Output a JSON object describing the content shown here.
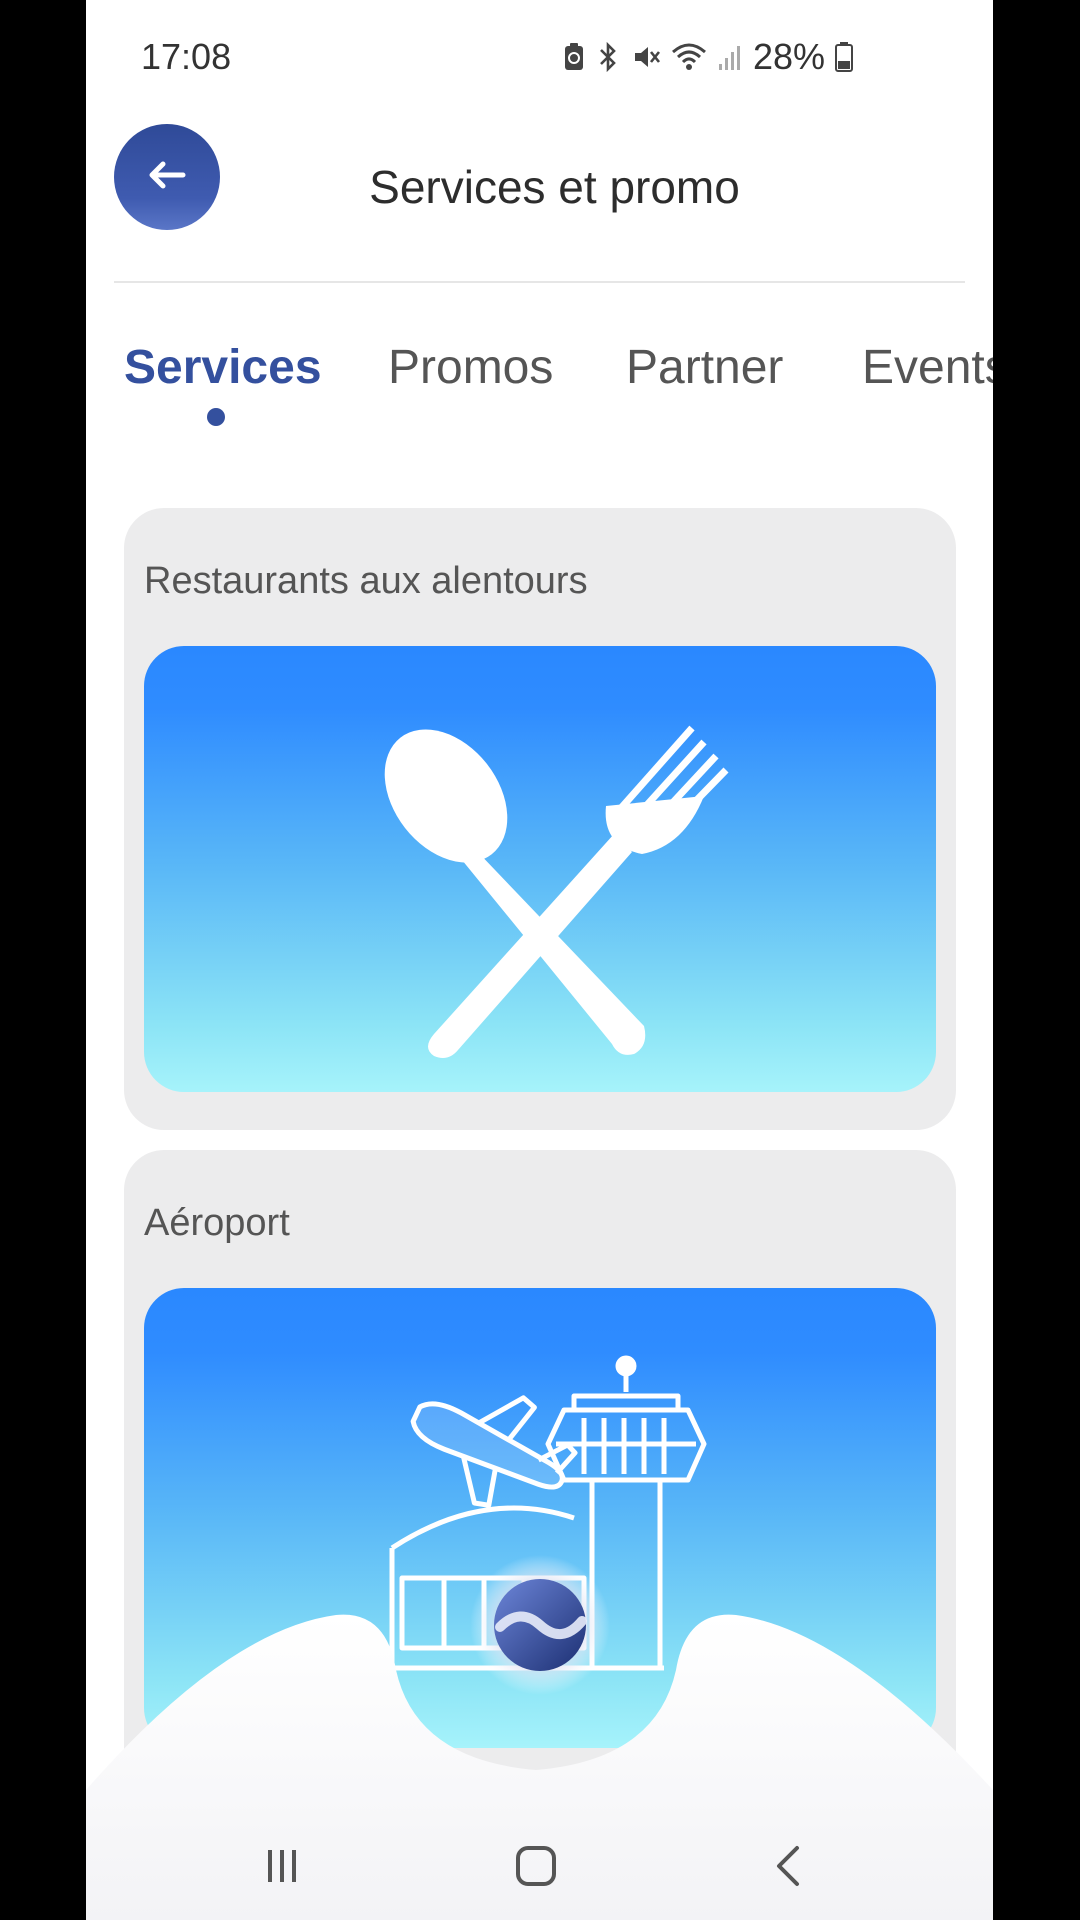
{
  "status_bar": {
    "time": "17:08",
    "battery": "28%",
    "icons": [
      "battery-saver-icon",
      "bluetooth-icon",
      "mute-icon",
      "wifi-icon",
      "signal-icon",
      "battery-icon"
    ]
  },
  "header": {
    "back_icon": "arrow-left-icon",
    "title": "Services et promo"
  },
  "tabs": [
    {
      "label": "Services",
      "active": true
    },
    {
      "label": "Promos",
      "active": false
    },
    {
      "label": "Partner",
      "active": false
    },
    {
      "label": "Events",
      "active": false
    }
  ],
  "cards": [
    {
      "title": "Restaurants aux alentours",
      "icon": "spoon-fork-icon"
    },
    {
      "title": "Aéroport",
      "icon": "airport-icon"
    }
  ],
  "nav": {
    "recents_icon": "recents-icon",
    "home_icon": "home-icon",
    "back_icon": "chevron-left-icon"
  },
  "colors": {
    "accent": "#34509e",
    "card_bg": "#ececed",
    "gradient_top": "#2a88ff",
    "gradient_bottom": "#a6f3fb"
  }
}
